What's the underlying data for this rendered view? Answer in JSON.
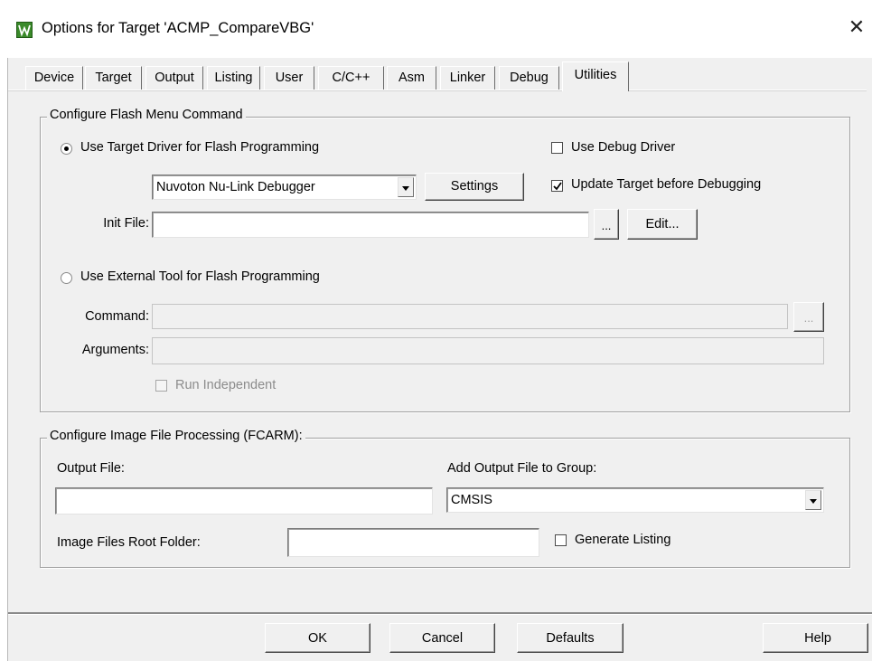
{
  "window": {
    "title": "Options for Target 'ACMP_CompareVBG'",
    "close_glyph": "✕",
    "icon": "keil-uvision-icon"
  },
  "tabs": [
    {
      "label": "Device"
    },
    {
      "label": "Target"
    },
    {
      "label": "Output"
    },
    {
      "label": "Listing"
    },
    {
      "label": "User"
    },
    {
      "label": "C/C++"
    },
    {
      "label": "Asm"
    },
    {
      "label": "Linker"
    },
    {
      "label": "Debug"
    },
    {
      "label": "Utilities"
    }
  ],
  "active_tab": "Utilities",
  "flash_group": {
    "title": "Configure Flash Menu Command",
    "use_target_driver": {
      "label": "Use Target Driver for Flash Programming",
      "selected": true
    },
    "use_debug_driver": {
      "label": "Use Debug Driver",
      "checked": false
    },
    "driver_select": {
      "value": "Nuvoton Nu-Link Debugger"
    },
    "settings_button": "Settings",
    "update_target": {
      "label": "Update Target before Debugging",
      "checked": true
    },
    "init_file": {
      "label": "Init File:",
      "value": ""
    },
    "browse_button": "...",
    "edit_button": "Edit...",
    "use_external_tool": {
      "label": "Use External Tool for Flash Programming",
      "selected": false
    },
    "command": {
      "label": "Command:",
      "value": ""
    },
    "command_browse": "...",
    "arguments": {
      "label": "Arguments:",
      "value": ""
    },
    "run_independent": {
      "label": "Run Independent",
      "checked": false
    }
  },
  "image_group": {
    "title": "Configure Image File Processing (FCARM):",
    "output_file": {
      "label": "Output File:",
      "value": ""
    },
    "add_output_group": {
      "label": "Add Output File  to Group:",
      "value": "CMSIS"
    },
    "root_folder": {
      "label": "Image Files Root Folder:",
      "value": ""
    },
    "generate_listing": {
      "label": "Generate Listing",
      "checked": false
    }
  },
  "footer": {
    "ok": "OK",
    "cancel": "Cancel",
    "defaults": "Defaults",
    "help": "Help"
  },
  "colors": {
    "dialog_bg": "#f0f0f0",
    "icon_green": "#3a8a2a"
  }
}
